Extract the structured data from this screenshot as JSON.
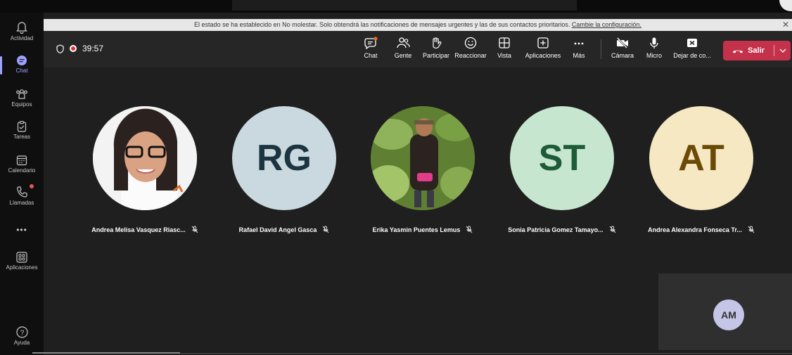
{
  "banner": {
    "text": "El estado se ha establecido en No molestar. Solo obtendrá las notificaciones de mensajes urgentes y las de sus contactos prioritarios.",
    "link": "Cambie la configuración.",
    "close": "✕"
  },
  "rail": {
    "items": [
      {
        "label": "Actividad",
        "icon": "bell-icon"
      },
      {
        "label": "Chat",
        "icon": "chat-icon",
        "active": true
      },
      {
        "label": "Equipos",
        "icon": "teams-icon"
      },
      {
        "label": "Tareas",
        "icon": "tasks-icon"
      },
      {
        "label": "Calendario",
        "icon": "calendar-icon"
      },
      {
        "label": "Llamadas",
        "icon": "phone-icon"
      },
      {
        "label": "•••",
        "icon": "more-icon"
      },
      {
        "label": "Aplicaciones",
        "icon": "apps-icon"
      },
      {
        "label": "Ayuda",
        "icon": "help-icon"
      }
    ]
  },
  "toolbar": {
    "timer": "39:57",
    "buttons": [
      {
        "label": "Chat",
        "icon": "chat-icon"
      },
      {
        "label": "Gente",
        "icon": "people-icon"
      },
      {
        "label": "Participar",
        "icon": "raise-hand-icon"
      },
      {
        "label": "Reaccionar",
        "icon": "smile-icon"
      },
      {
        "label": "Vista",
        "icon": "grid-icon"
      },
      {
        "label": "Aplicaciones",
        "icon": "plus-square-icon"
      },
      {
        "label": "Más",
        "icon": "more-icon"
      },
      {
        "label": "Cámara",
        "icon": "camera-off-icon"
      },
      {
        "label": "Micro",
        "icon": "mic-icon"
      },
      {
        "label": "Dejar de co...",
        "icon": "stop-share-icon"
      }
    ],
    "leave_label": "Salir"
  },
  "participants": [
    {
      "name": "Andrea Melisa Vasquez Riasc...",
      "initials": "",
      "photo": true,
      "bg": "#f2f2f2"
    },
    {
      "name": "Rafael David Angel Gasca",
      "initials": "RG",
      "bg": "#c9d9df",
      "fg": "#1d3540"
    },
    {
      "name": "Erika Yasmin Puentes Lemus",
      "initials": "",
      "photo": true,
      "bg": "#6a8a3a"
    },
    {
      "name": "Sonia Patricia Gomez Tamayo...",
      "initials": "ST",
      "bg": "#c7e6d0",
      "fg": "#1e5c37"
    },
    {
      "name": "Andrea Alexandra Fonseca Tr...",
      "initials": "AT",
      "bg": "#f6e8c3",
      "fg": "#6b4a06"
    }
  ],
  "self_view": {
    "initials": "AM"
  },
  "colors": {
    "accent": "#9ea2ff",
    "leave": "#c4314b"
  }
}
